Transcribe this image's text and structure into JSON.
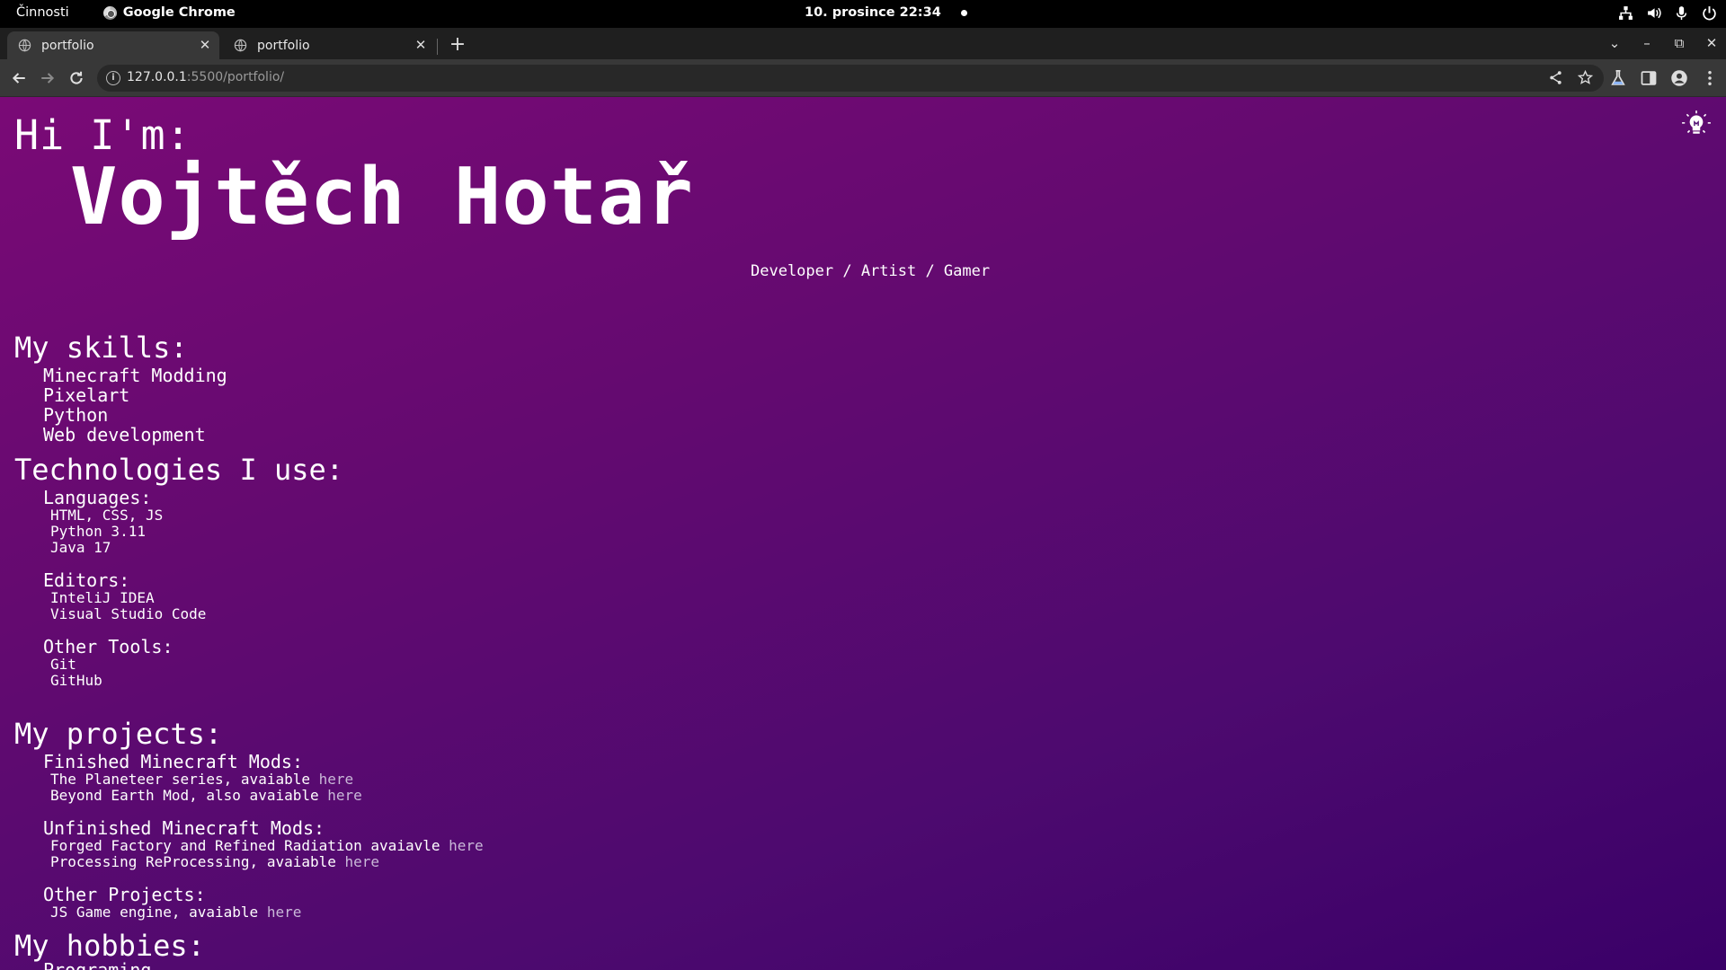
{
  "system_bar": {
    "activities": "Činnosti",
    "app_name": "Google Chrome",
    "clock": "10. prosince  22:34"
  },
  "browser": {
    "tabs": [
      {
        "title": "portfolio",
        "active": true
      },
      {
        "title": "portfolio",
        "active": false
      }
    ],
    "url_host": "127.0.0.1",
    "url_rest": ":5500/portfolio/"
  },
  "page": {
    "greeting": "Hi I'm:",
    "name": "Vojtěch Hotař",
    "roles": "Developer / Artist / Gamer",
    "skills": {
      "title": "My skills:",
      "items": [
        "Minecraft Modding",
        "Pixelart",
        "Python",
        "Web development"
      ]
    },
    "technologies": {
      "title": "Technologies I use:",
      "groups": [
        {
          "label": "Languages:",
          "items": [
            "HTML, CSS, JS",
            "Python 3.11",
            "Java 17"
          ]
        },
        {
          "label": "Editors:",
          "items": [
            "InteliJ IDEA",
            "Visual Studio Code"
          ]
        },
        {
          "label": "Other Tools:",
          "items": [
            "Git",
            "GitHub"
          ]
        }
      ]
    },
    "projects": {
      "title": "My projects:",
      "groups": [
        {
          "label": "Finished Minecraft Mods:",
          "items": [
            {
              "text": "The Planeteer series, avaiable ",
              "link": "here"
            },
            {
              "text": "Beyond Earth Mod, also avaiable ",
              "link": "here"
            }
          ]
        },
        {
          "label": "Unfinished Minecraft Mods:",
          "items": [
            {
              "text": "Forged Factory and Refined Radiation avaiavle ",
              "link": "here"
            },
            {
              "text": "Processing ReProcessing, avaiable ",
              "link": "here"
            }
          ]
        },
        {
          "label": "Other Projects:",
          "items": [
            {
              "text": "JS Game engine, avaiable ",
              "link": "here"
            }
          ]
        }
      ]
    },
    "hobbies": {
      "title": "My hobbies:",
      "items": [
        "Programing"
      ]
    }
  },
  "colors": {
    "page_gradient_start": "#7a0a76",
    "page_gradient_end": "#3a0068",
    "link": "#c9b8d8"
  }
}
